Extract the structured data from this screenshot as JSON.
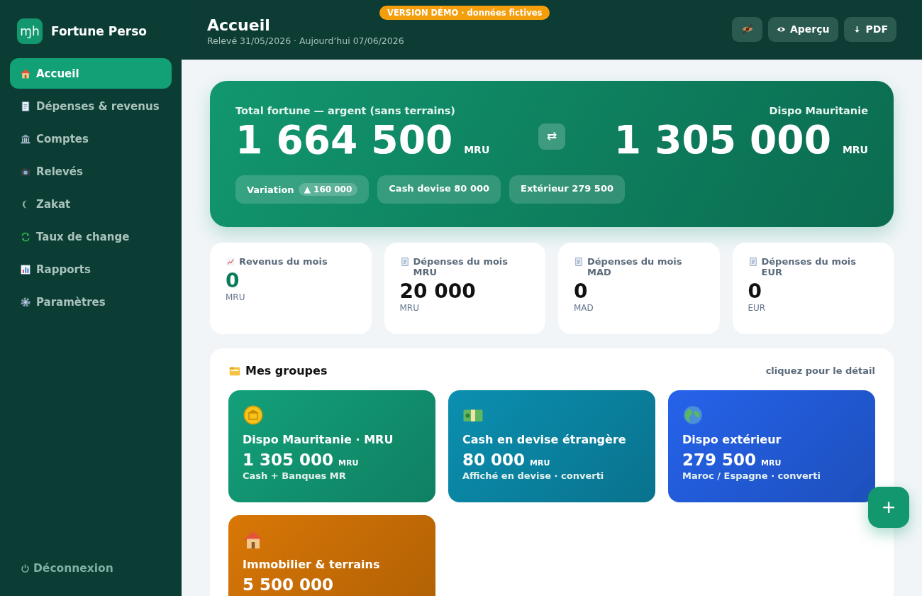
{
  "sidebar": {
    "brand": {
      "logo": "ɱh",
      "name": "Fortune Perso"
    },
    "items": [
      {
        "label": "Accueil",
        "selected": true
      },
      {
        "label": "Dépenses & revenus",
        "selected": false
      },
      {
        "label": "Comptes",
        "selected": false
      },
      {
        "label": "Relevés",
        "selected": false
      },
      {
        "label": "Zakat",
        "selected": false
      },
      {
        "label": "Taux de change",
        "selected": false
      },
      {
        "label": "Rapports",
        "selected": false
      },
      {
        "label": "Paramètres",
        "selected": false
      }
    ],
    "logout": "Déconnexion"
  },
  "header": {
    "title": "Accueil",
    "subtitle": "Relevé 31/05/2026 · Aujourd’hui 07/06/2026",
    "demo_badge": "VERSION DÉMO · données fictives",
    "buttons": [
      {
        "kind": "hide"
      },
      {
        "kind": "preview",
        "label": "Aperçu"
      },
      {
        "kind": "download",
        "label": "PDF"
      }
    ]
  },
  "hero": {
    "left": {
      "label": "Total fortune — argent (sans terrains)",
      "amount": "1 664 500",
      "unit": "MRU"
    },
    "swap": "⇄",
    "right": {
      "label": "Dispo Mauritanie",
      "amount": "1 305 000",
      "unit": "MRU"
    },
    "chips": [
      {
        "label": "Variation",
        "badge": "▲ 160 000"
      },
      {
        "label": "Cash devise 80 000"
      },
      {
        "label": "Extérieur 279 500"
      }
    ]
  },
  "stats": [
    {
      "kind": "income",
      "label": "Revenus du mois",
      "value": "0",
      "unit": "MRU"
    },
    {
      "kind": "expense",
      "label": "Dépenses du mois MRU",
      "value": "20 000",
      "unit": "MRU"
    },
    {
      "kind": "expense",
      "label": "Dépenses du mois MAD",
      "value": "0",
      "unit": "MAD"
    },
    {
      "kind": "expense",
      "label": "Dépenses du mois EUR",
      "value": "0",
      "unit": "EUR"
    }
  ],
  "groups": {
    "title": "Mes groupes",
    "hint": "cliquez pour le détail",
    "cards": [
      {
        "title": "Dispo Mauritanie · MRU",
        "amount": "1 305 000",
        "unit": "MRU",
        "note": "Cash + Banques MR",
        "color": "#13a07a"
      },
      {
        "title": "Cash en devise étrangère",
        "amount": "80 000",
        "unit": "MRU",
        "note": "Affiché en devise · converti",
        "color": "#0b8fb0"
      },
      {
        "title": "Dispo extérieur",
        "amount": "279 500",
        "unit": "MRU",
        "note": "Maroc / Espagne · converti",
        "color": "#2563eb"
      },
      {
        "title": "Immobilier & terrains",
        "amount": "5 500 000",
        "color": "#d97706"
      }
    ]
  },
  "fab": "+"
}
